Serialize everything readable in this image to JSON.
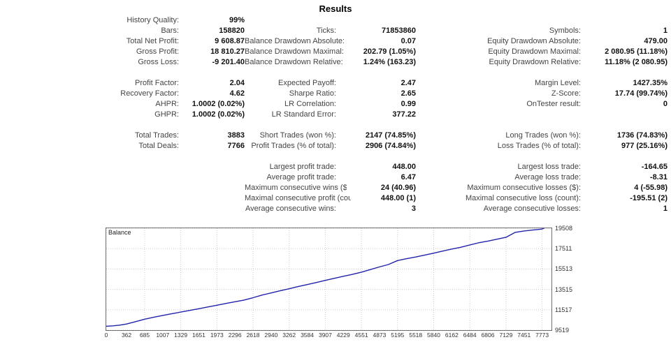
{
  "report": {
    "title": "Results"
  },
  "stats": [
    [
      {
        "label": "History Quality:",
        "value": "99%"
      },
      {
        "label": "",
        "value": ""
      },
      {
        "label": "",
        "value": ""
      }
    ],
    [
      {
        "label": "Bars:",
        "value": "158820"
      },
      {
        "label": "Ticks:",
        "value": "71853860"
      },
      {
        "label": "Symbols:",
        "value": "1"
      }
    ],
    [
      {
        "label": "Total Net Profit:",
        "value": "9 608.87"
      },
      {
        "label": "Balance Drawdown Absolute:",
        "value": "0.07"
      },
      {
        "label": "Equity Drawdown Absolute:",
        "value": "479.00"
      }
    ],
    [
      {
        "label": "Gross Profit:",
        "value": "18 810.27"
      },
      {
        "label": "Balance Drawdown Maximal:",
        "value": "202.79 (1.05%)"
      },
      {
        "label": "Equity Drawdown Maximal:",
        "value": "2 080.95 (11.18%)"
      }
    ],
    [
      {
        "label": "Gross Loss:",
        "value": "-9 201.40"
      },
      {
        "label": "Balance Drawdown Relative:",
        "value": "1.24% (163.23)"
      },
      {
        "label": "Equity Drawdown Relative:",
        "value": "11.18% (2 080.95)"
      }
    ],
    [
      {
        "label": "Profit Factor:",
        "value": "2.04"
      },
      {
        "label": "Expected Payoff:",
        "value": "2.47"
      },
      {
        "label": "Margin Level:",
        "value": "1427.35%"
      }
    ],
    [
      {
        "label": "Recovery Factor:",
        "value": "4.62"
      },
      {
        "label": "Sharpe Ratio:",
        "value": "2.65"
      },
      {
        "label": "Z-Score:",
        "value": "17.74 (99.74%)"
      }
    ],
    [
      {
        "label": "AHPR:",
        "value": "1.0002 (0.02%)"
      },
      {
        "label": "LR Correlation:",
        "value": "0.99"
      },
      {
        "label": "OnTester result:",
        "value": "0"
      }
    ],
    [
      {
        "label": "GHPR:",
        "value": "1.0002 (0.02%)"
      },
      {
        "label": "LR Standard Error:",
        "value": "377.22"
      },
      {
        "label": "",
        "value": ""
      }
    ],
    [
      {
        "label": "Total Trades:",
        "value": "3883"
      },
      {
        "label": "Short Trades (won %):",
        "value": "2147 (74.85%)"
      },
      {
        "label": "Long Trades (won %):",
        "value": "1736 (74.83%)"
      }
    ],
    [
      {
        "label": "Total Deals:",
        "value": "7766"
      },
      {
        "label": "Profit Trades (% of total):",
        "value": "2906 (74.84%)"
      },
      {
        "label": "Loss Trades (% of total):",
        "value": "977 (25.16%)"
      }
    ],
    [
      {
        "label": "",
        "value": ""
      },
      {
        "label": "Largest profit trade:",
        "value": "448.00"
      },
      {
        "label": "Largest loss trade:",
        "value": "-164.65"
      }
    ],
    [
      {
        "label": "",
        "value": ""
      },
      {
        "label": "Average profit trade:",
        "value": "6.47"
      },
      {
        "label": "Average loss trade:",
        "value": "-8.31"
      }
    ],
    [
      {
        "label": "",
        "value": ""
      },
      {
        "label": "Maximum consecutive wins ($):",
        "value": "24 (40.96)"
      },
      {
        "label": "Maximum consecutive losses ($):",
        "value": "4 (-55.98)"
      }
    ],
    [
      {
        "label": "",
        "value": ""
      },
      {
        "label": "Maximal consecutive profit (count):",
        "value": "448.00 (1)"
      },
      {
        "label": "Maximal consecutive loss (count):",
        "value": "-195.51 (2)"
      }
    ],
    [
      {
        "label": "",
        "value": ""
      },
      {
        "label": "Average consecutive wins:",
        "value": "3"
      },
      {
        "label": "Average consecutive losses:",
        "value": "1"
      }
    ]
  ],
  "block_breaks_after_row": [
    4,
    8,
    10
  ],
  "chart_data": {
    "type": "line",
    "title": "",
    "legend": [
      "Balance"
    ],
    "legend_position": "top-left",
    "line_color": "#2222aa",
    "grid": true,
    "xlabel": "",
    "ylabel": "",
    "xlim": [
      0,
      7940
    ],
    "ylim": [
      9519,
      19508
    ],
    "x_ticks": [
      0,
      362,
      685,
      1007,
      1329,
      1651,
      1973,
      2296,
      2618,
      2940,
      3262,
      3584,
      3907,
      4229,
      4551,
      4873,
      5195,
      5518,
      5840,
      6162,
      6484,
      6806,
      7129,
      7451,
      7773
    ],
    "y_ticks": [
      9519,
      11517,
      13515,
      15513,
      17511,
      19508
    ],
    "series": [
      {
        "name": "Balance",
        "x": [
          0,
          120,
          240,
          362,
          500,
          685,
          850,
          1007,
          1170,
          1329,
          1490,
          1651,
          1810,
          1973,
          2130,
          2296,
          2450,
          2618,
          2780,
          2940,
          3100,
          3262,
          3420,
          3584,
          3750,
          3907,
          4070,
          4229,
          4390,
          4551,
          4710,
          4873,
          5030,
          5195,
          5350,
          5518,
          5680,
          5840,
          6000,
          6162,
          6320,
          6484,
          6640,
          6806,
          6960,
          7129,
          7290,
          7451,
          7600,
          7773,
          7900,
          7940
        ],
        "y": [
          9900,
          9940,
          10010,
          10120,
          10320,
          10590,
          10790,
          10960,
          11130,
          11290,
          11460,
          11620,
          11790,
          11960,
          12130,
          12300,
          12460,
          12700,
          12960,
          13170,
          13380,
          13580,
          13790,
          13990,
          14190,
          14400,
          14600,
          14800,
          14990,
          15200,
          15460,
          15720,
          15950,
          16340,
          16520,
          16690,
          16880,
          17070,
          17270,
          17470,
          17640,
          17870,
          18080,
          18250,
          18430,
          18620,
          19100,
          19240,
          19330,
          19430,
          19760,
          19790
        ]
      }
    ]
  }
}
